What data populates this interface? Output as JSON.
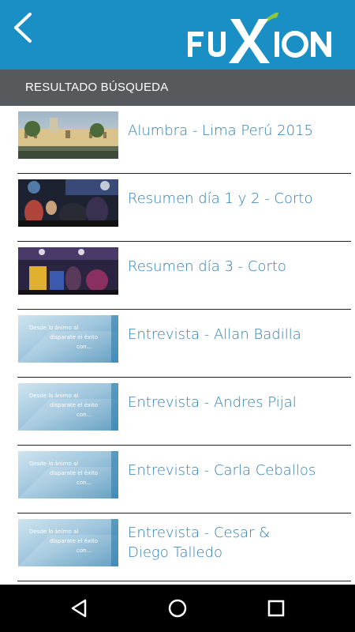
{
  "header": {
    "back_icon": "chevron-left-icon",
    "logo_text": "FUXION",
    "brand_color": "#1a8fc5"
  },
  "subheader": {
    "title": "RESULTADO BÚSQUEDA"
  },
  "results": [
    {
      "title": "Alumbra - Lima Perú 2015",
      "thumbnail": "plaza-photo"
    },
    {
      "title": "Resumen día 1 y 2 - Corto",
      "thumbnail": "concert-crowd-photo"
    },
    {
      "title": "Resumen día 3 - Corto",
      "thumbnail": "concert-crowd-photo"
    },
    {
      "title": "Entrevista - Allan Badilla",
      "thumbnail": "interview-card"
    },
    {
      "title": "Entrevista - Andres Pijal",
      "thumbnail": "interview-card"
    },
    {
      "title": "Entrevista - Carla Ceballos",
      "thumbnail": "interview-card"
    },
    {
      "title": "Entrevista - Cesar & Diego Talledo",
      "thumbnail": "interview-card"
    }
  ],
  "interview_thumb_text": [
    "Desde lo",
    "ánimo al",
    "disparate el éxito",
    "con..."
  ],
  "navbar": {
    "back": "back-triangle-icon",
    "home": "home-circle-icon",
    "recents": "recents-square-icon"
  }
}
